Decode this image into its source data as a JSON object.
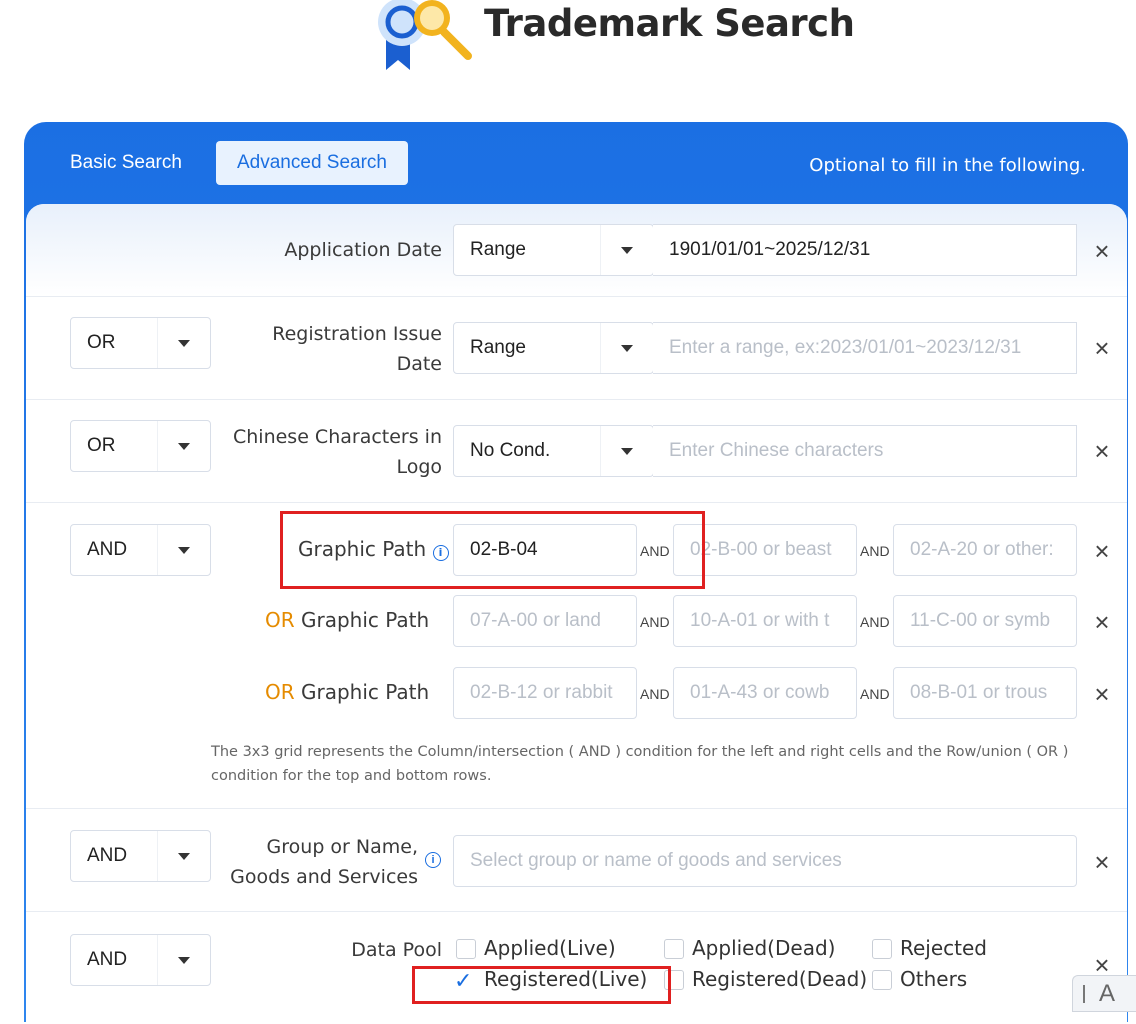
{
  "header": {
    "title": "Trademark Search"
  },
  "tabs": {
    "basic": "Basic Search",
    "advanced": "Advanced Search",
    "hint": "Optional to fill in the following."
  },
  "rows": {
    "application_date": {
      "label": "Application Date",
      "select": "Range",
      "value": "1901/01/01~2025/12/31"
    },
    "registration_issue_date": {
      "op": "OR",
      "label_1": "Registration Issue",
      "label_2": "Date",
      "select": "Range",
      "placeholder": "Enter a range, ex:2023/01/01~2023/12/31"
    },
    "chinese_characters": {
      "op": "OR",
      "label_1": "Chinese Characters in",
      "label_2": "Logo",
      "select": "No Cond.",
      "placeholder": "Enter Chinese characters"
    },
    "graphic_path": {
      "op": "AND",
      "label": "Graphic Path",
      "or_word": "OR",
      "or_label": "Graphic Path",
      "and_word": "AND",
      "grid": [
        {
          "value": "02-B-04",
          "ph2": "02-B-00 or beast",
          "ph3": "02-A-20 or other:"
        },
        {
          "ph1": "07-A-00 or land",
          "ph2": "10-A-01 or with t",
          "ph3": "11-C-00 or symb"
        },
        {
          "ph1": "02-B-12 or rabbit",
          "ph2": "01-A-43 or cowb",
          "ph3": "08-B-01 or trous"
        }
      ],
      "note": "The 3x3 grid represents the Column/intersection ( AND ) condition for the left and right cells and the Row/union ( OR ) condition for the top and bottom rows."
    },
    "goods_services": {
      "op": "AND",
      "label_1": "Group or Name,",
      "label_2": "Goods and Services",
      "placeholder": "Select group or name of goods and services"
    },
    "data_pool": {
      "op": "AND",
      "label": "Data Pool",
      "options": [
        "Applied(Live)",
        "Applied(Dead)",
        "Rejected",
        "Registered(Live)",
        "Registered(Dead)",
        "Others"
      ],
      "checked": [
        "Registered(Live)"
      ]
    }
  },
  "icons": {
    "close": "×",
    "info": "i",
    "caret": "caret-down-icon",
    "check": "✓"
  },
  "colors": {
    "accent": "#1a6ee0",
    "or_orange": "#e58b00",
    "highlight": "#e02020"
  }
}
